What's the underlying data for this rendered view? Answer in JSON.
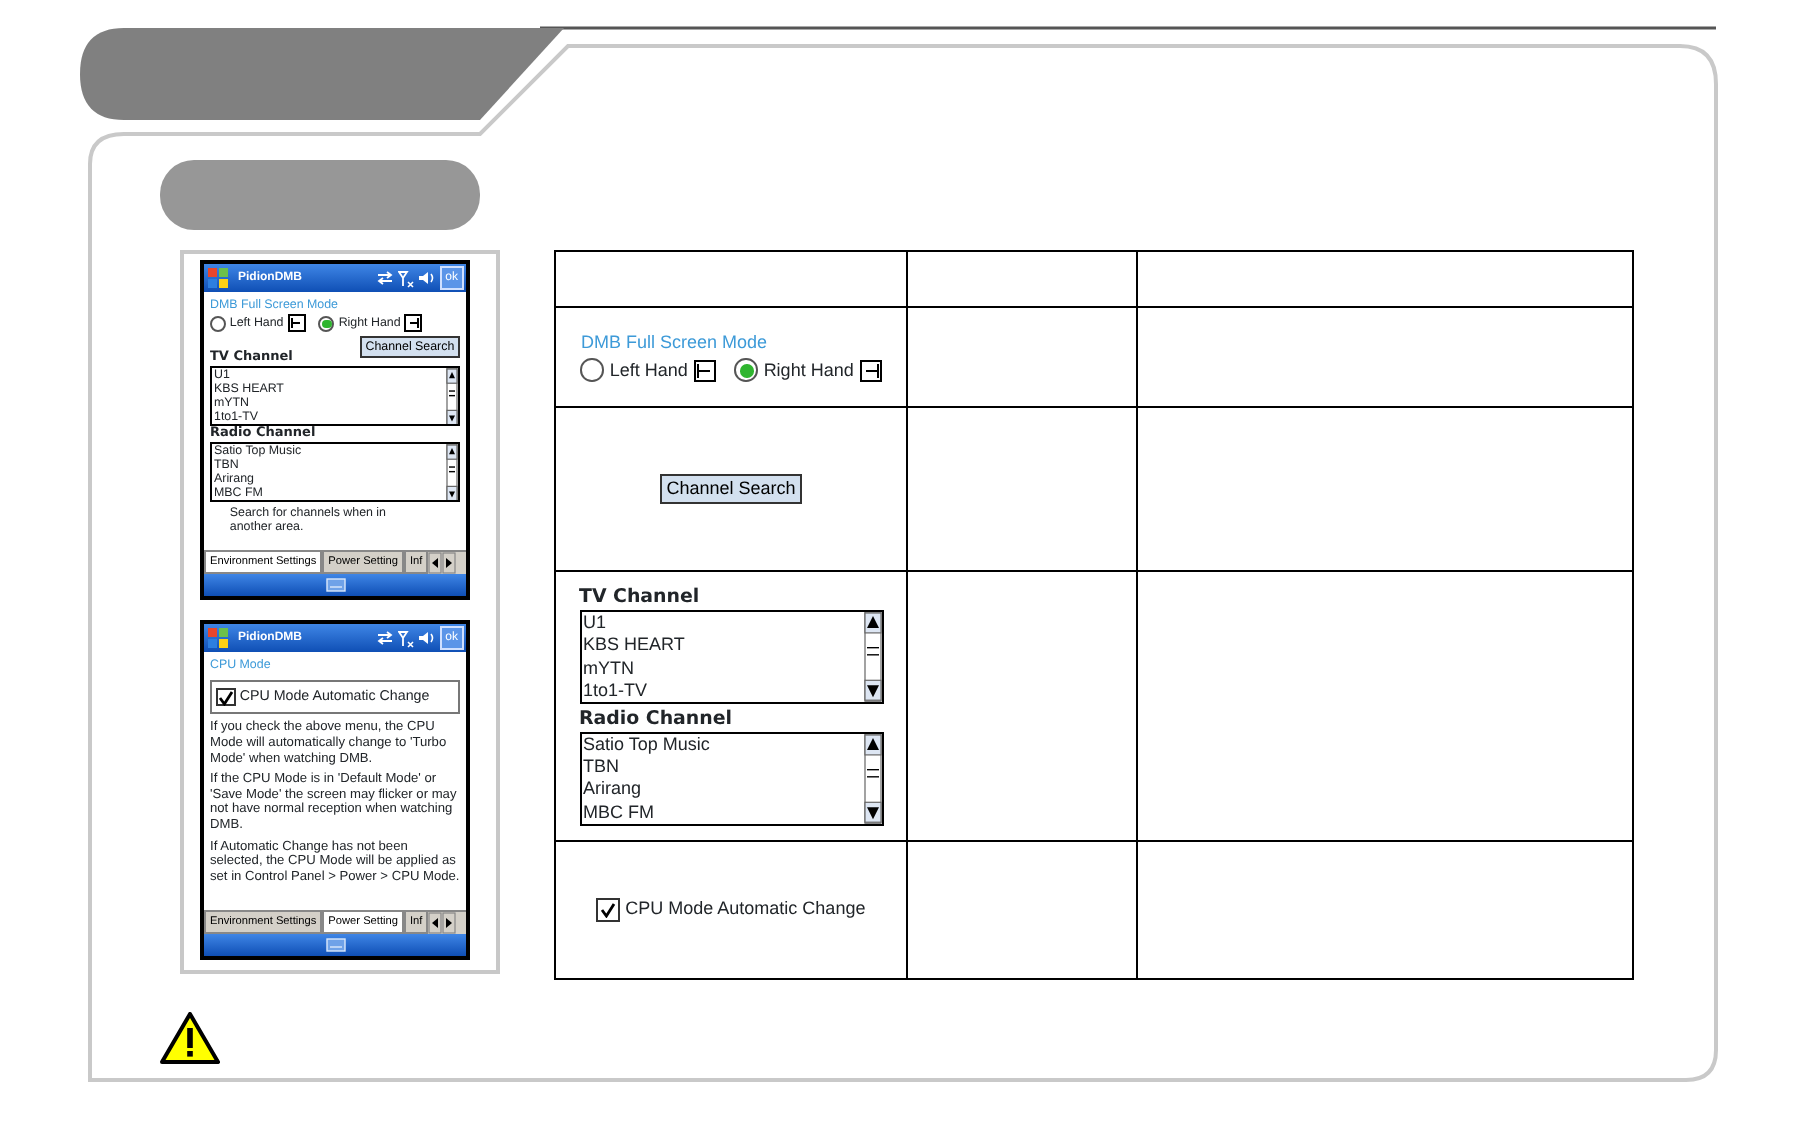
{
  "screenshots": [
    {
      "title": "PidionDMB",
      "ok": "ok",
      "blocks": [
        {
          "kind": "section",
          "text": "DMB Full Screen Mode"
        },
        {
          "kind": "radios",
          "items": [
            {
              "label": "Left Hand",
              "selected": false
            },
            {
              "label": "Right Hand",
              "selected": true
            }
          ]
        },
        {
          "kind": "button",
          "text": "Channel Search"
        },
        {
          "kind": "list",
          "title": "TV Channel",
          "items": [
            "U1",
            "KBS HEART",
            "mYTN",
            "1to1-TV"
          ]
        },
        {
          "kind": "list",
          "title": "Radio Channel",
          "items": [
            "Satio Top Music",
            "TBN",
            "Arirang",
            "MBC FM"
          ]
        },
        {
          "kind": "note",
          "text": "Search for channels when in another area."
        }
      ],
      "tabs": [
        {
          "label": "Environment Settings",
          "selected": true
        },
        {
          "label": "Power Setting",
          "selected": false
        },
        {
          "label": "Inf",
          "selected": false
        }
      ]
    },
    {
      "title": "PidionDMB",
      "ok": "ok",
      "blocks": [
        {
          "kind": "section",
          "text": "CPU Mode"
        },
        {
          "kind": "checkbox",
          "label": "CPU Mode Automatic Change",
          "checked": true,
          "framed": true
        },
        {
          "kind": "paragraph",
          "text": "If you check the above menu, the CPU Mode will automatically change to 'Turbo Mode' when watching DMB."
        },
        {
          "kind": "paragraph",
          "text": "If the CPU Mode is in 'Default Mode' or 'Save Mode' the screen may flicker or may not have normal reception when watching DMB."
        },
        {
          "kind": "paragraph",
          "text": "If Automatic Change has not been selected, the CPU Mode will be applied as set in Control Panel > Power > CPU Mode."
        }
      ],
      "tabs": [
        {
          "label": "Environment Settings",
          "selected": false
        },
        {
          "label": "Power Setting",
          "selected": true
        },
        {
          "label": "Inf",
          "selected": false
        }
      ]
    }
  ],
  "table": {
    "rows": [
      {
        "blocks": [
          {
            "kind": "section",
            "text": "DMB Full Screen Mode"
          },
          {
            "kind": "radios",
            "items": [
              {
                "label": "Left Hand",
                "selected": false
              },
              {
                "label": "Right Hand",
                "selected": true
              }
            ]
          }
        ]
      },
      {
        "blocks": [
          {
            "kind": "button",
            "text": "Channel Search"
          }
        ]
      },
      {
        "blocks": [
          {
            "kind": "list",
            "title": "TV Channel",
            "items": [
              "U1",
              "KBS HEART",
              "mYTN",
              "1to1-TV"
            ]
          },
          {
            "kind": "list",
            "title": "Radio Channel",
            "items": [
              "Satio Top Music",
              "TBN",
              "Arirang",
              "MBC FM"
            ]
          }
        ]
      },
      {
        "blocks": [
          {
            "kind": "checkbox",
            "label": "CPU Mode Automatic Change",
            "checked": true,
            "framed": false
          }
        ]
      }
    ]
  }
}
